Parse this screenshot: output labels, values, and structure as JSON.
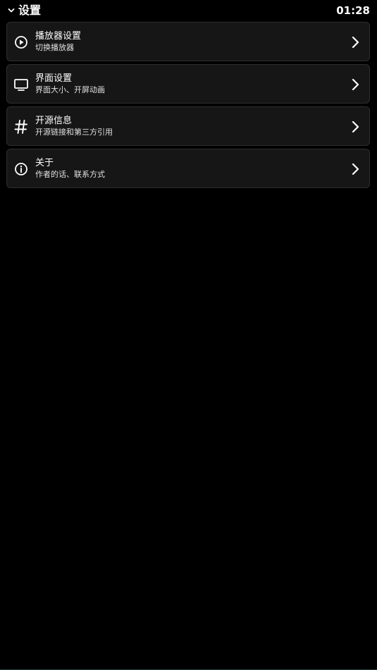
{
  "header": {
    "back_icon": "chevron-down-icon",
    "title": "设置",
    "time": "01:28"
  },
  "settings": {
    "items": [
      {
        "icon": "play-circle-icon",
        "title": "播放器设置",
        "subtitle": "切换播放器"
      },
      {
        "icon": "monitor-icon",
        "title": "界面设置",
        "subtitle": "界面大小、开屏动画"
      },
      {
        "icon": "hash-icon",
        "title": "开源信息",
        "subtitle": "开源链接和第三方引用"
      },
      {
        "icon": "info-circle-icon",
        "title": "关于",
        "subtitle": "作者的话、联系方式"
      }
    ]
  },
  "colors": {
    "background": "#000000",
    "card": "#161616",
    "card_border": "#2e2e2e",
    "text": "#ffffff"
  }
}
